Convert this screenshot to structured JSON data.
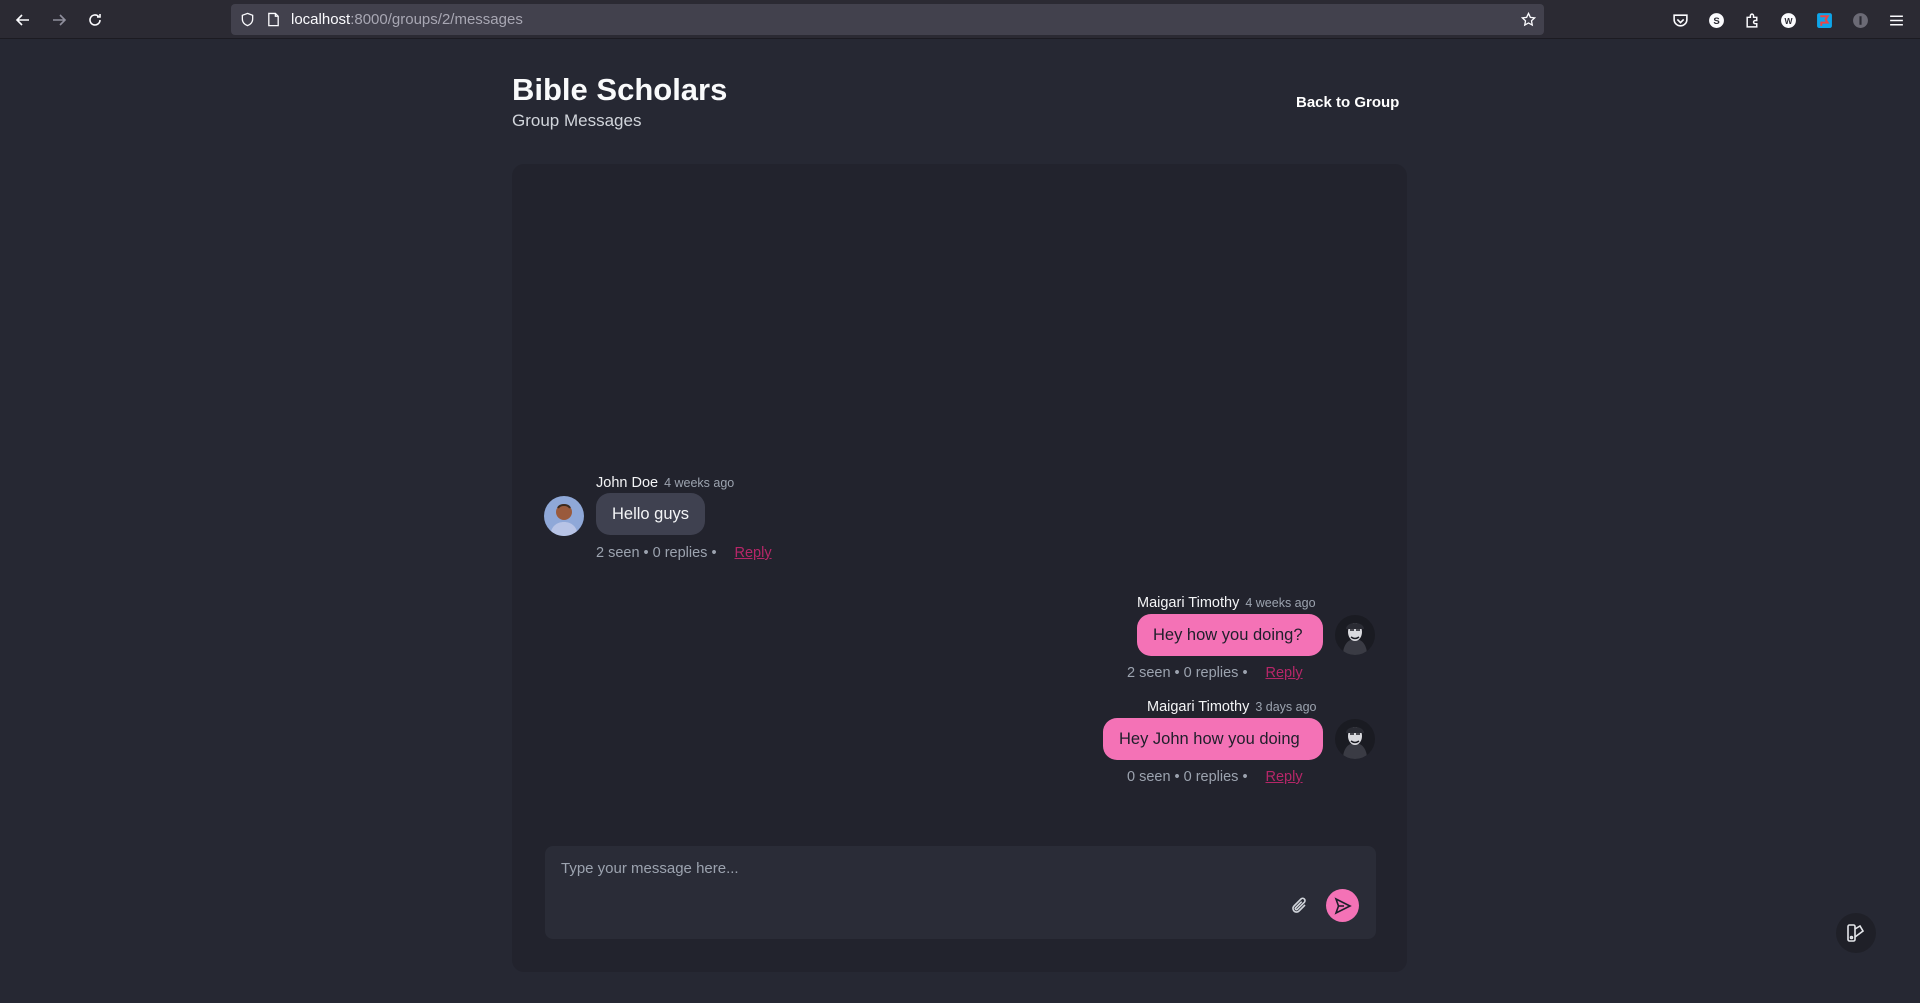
{
  "browser": {
    "url_host": "localhost",
    "url_path": ":8000/groups/2/messages"
  },
  "header": {
    "title": "Bible Scholars",
    "subtitle": "Group Messages",
    "back_label": "Back to Group"
  },
  "messages": [
    {
      "author": "John Doe",
      "time": "4 weeks ago",
      "text": "Hello guys",
      "seen": "2 seen",
      "replies": "0 replies",
      "reply_label": "Reply",
      "own": false
    },
    {
      "author": "Maigari Timothy",
      "time": "4 weeks ago",
      "text": "Hey how you doing?",
      "seen": "2 seen",
      "replies": "0 replies",
      "reply_label": "Reply",
      "own": true
    },
    {
      "author": "Maigari Timothy",
      "time": "3 days ago",
      "text": "Hey John how you doing",
      "seen": "0 seen",
      "replies": "0 replies",
      "reply_label": "Reply",
      "own": true
    }
  ],
  "composer": {
    "placeholder": "Type your message here...",
    "value": ""
  },
  "colors": {
    "accent": "#f472b6",
    "background": "#262833",
    "panel": "#22232d"
  }
}
